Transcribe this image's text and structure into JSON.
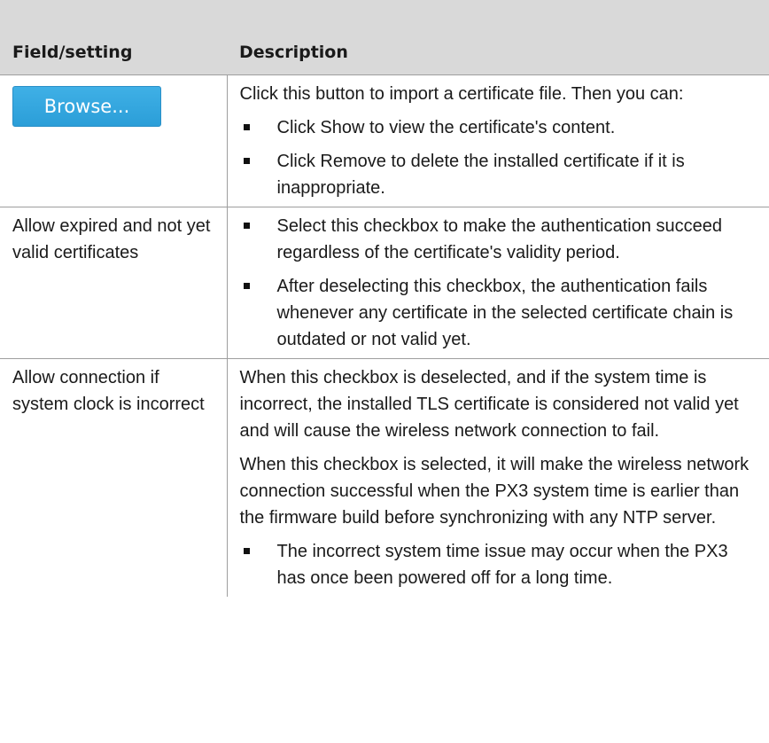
{
  "table": {
    "header": {
      "field": "Field/setting",
      "description": "Description"
    },
    "rows": [
      {
        "field_button": "Browse...",
        "intro": "Click this button to import a certificate file. Then you can:",
        "bullets": [
          "Click Show to view the certificate's content.",
          "Click Remove to delete the installed certificate if it is inappropriate."
        ]
      },
      {
        "field": "Allow expired and not yet valid certificates",
        "bullets": [
          "Select this checkbox to make the authentication succeed regardless of the certificate's validity period.",
          "After deselecting this checkbox, the authentication fails whenever any certificate in the selected certificate chain is outdated or not valid yet."
        ]
      },
      {
        "field": "Allow connection if system clock is incorrect",
        "paragraphs": [
          "When this checkbox is deselected, and if the system time is incorrect, the installed TLS certificate is considered not valid yet and will cause the wireless network connection to fail.",
          "When this checkbox is selected, it will make the wireless network connection successful when the PX3 system time is earlier than the firmware build before synchronizing with any NTP server."
        ],
        "bullets": [
          "The incorrect system time issue may occur when the PX3 has once been powered off for a long time."
        ]
      }
    ]
  }
}
